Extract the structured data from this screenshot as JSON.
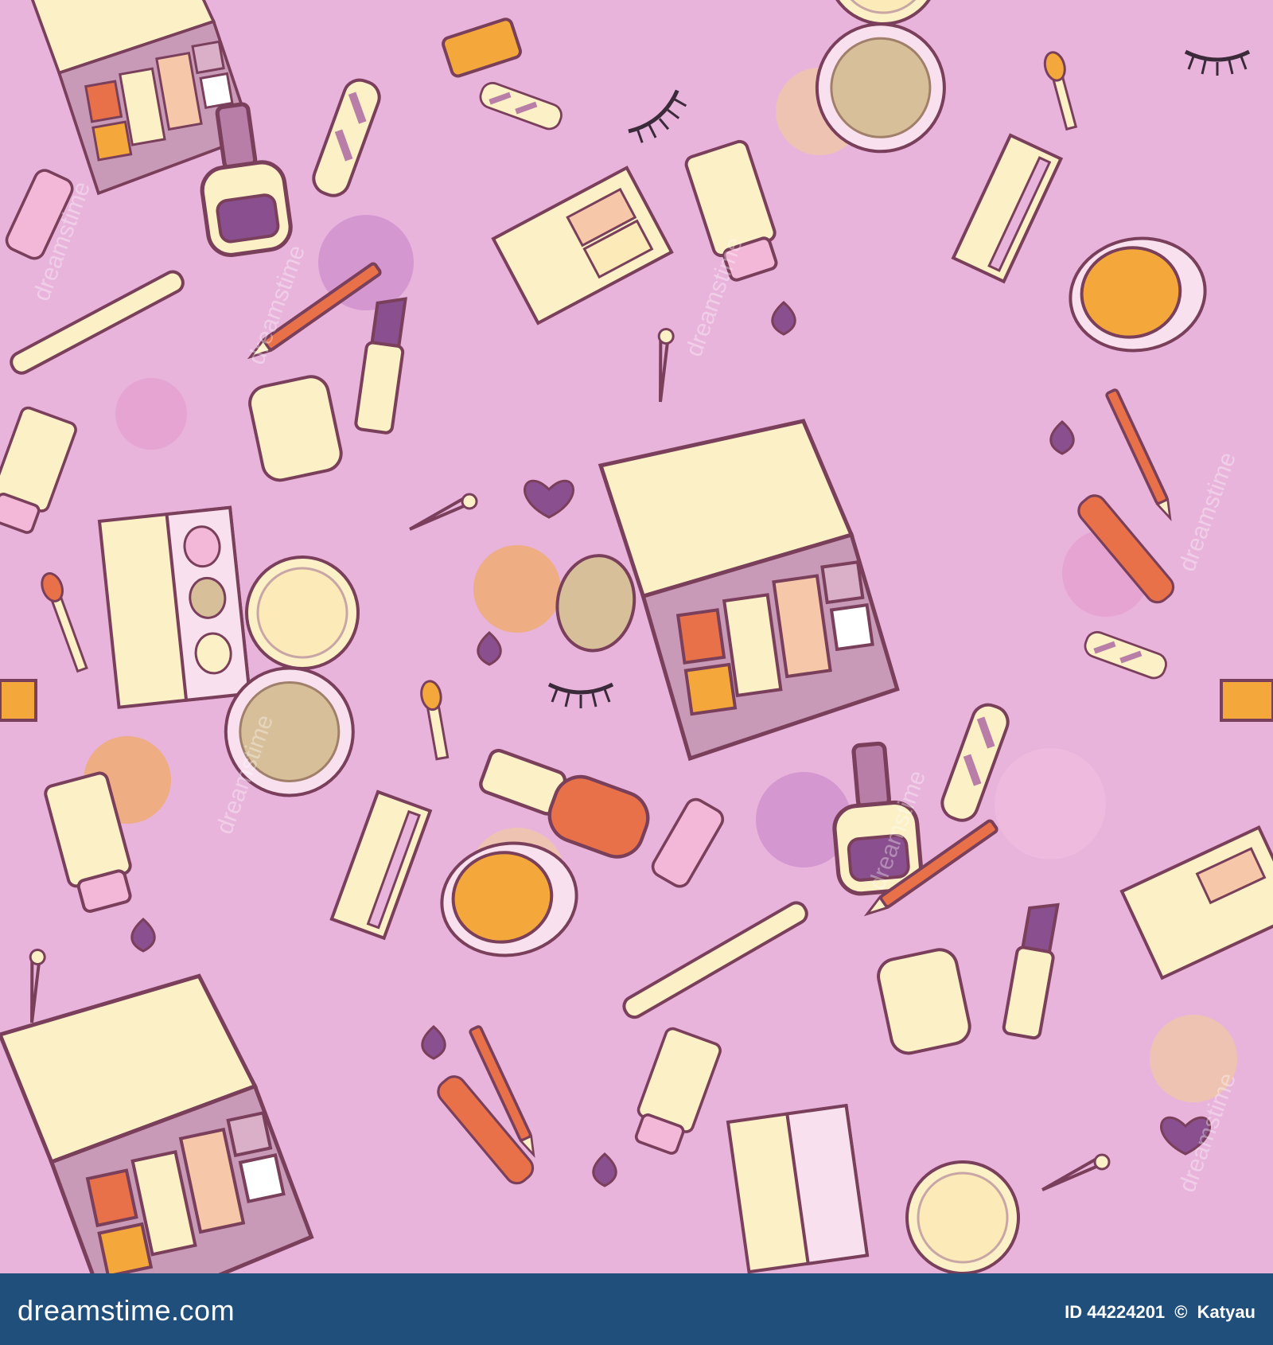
{
  "image": {
    "subject": "seamless-cosmetics-doodle-pattern",
    "palette": {
      "background": "#e8b4dc",
      "pale_yellow": "#fbf0c6",
      "orange": "#f4a83c",
      "coral": "#e8714a",
      "purple": "#8a4f8f",
      "pink": "#f3b7d8",
      "outline": "#7a3f5a",
      "footer": "#1f4f7a"
    },
    "icons": [
      "eyeshadow-palette-icon",
      "nail-polish-icon",
      "lipstick-icon",
      "powder-compact-icon",
      "cream-jar-icon",
      "comb-icon",
      "mascara-icon",
      "tube-icon",
      "nail-file-icon",
      "pencil-icon",
      "sponge-icon",
      "safety-pin-icon",
      "eyelash-icon",
      "heart-keychain-icon",
      "applicator-icon",
      "droplet-icon"
    ]
  },
  "watermark": {
    "text": "dreamstime"
  },
  "footer": {
    "site": "dreamstime.com",
    "id_label": "ID 44224201",
    "separator": "©",
    "author": "Katyau"
  }
}
